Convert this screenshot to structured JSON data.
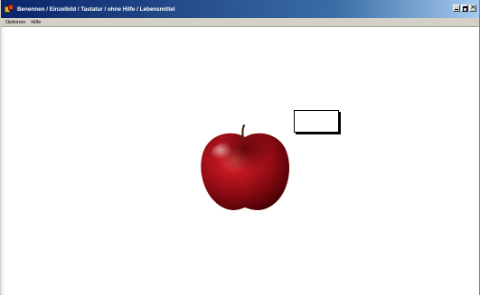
{
  "window": {
    "title": "Benennen / Einzelbild / Tastatur / ohne Hilfe / Lebensmittel",
    "controls": [
      "minimize",
      "maximize",
      "close"
    ]
  },
  "menubar": {
    "items": [
      {
        "label": "Optionen"
      },
      {
        "label": "Hilfe"
      }
    ]
  },
  "content": {
    "image": {
      "name": "apple-image",
      "subject": "red apple"
    },
    "answer_field": {
      "value": "",
      "placeholder": ""
    }
  }
}
